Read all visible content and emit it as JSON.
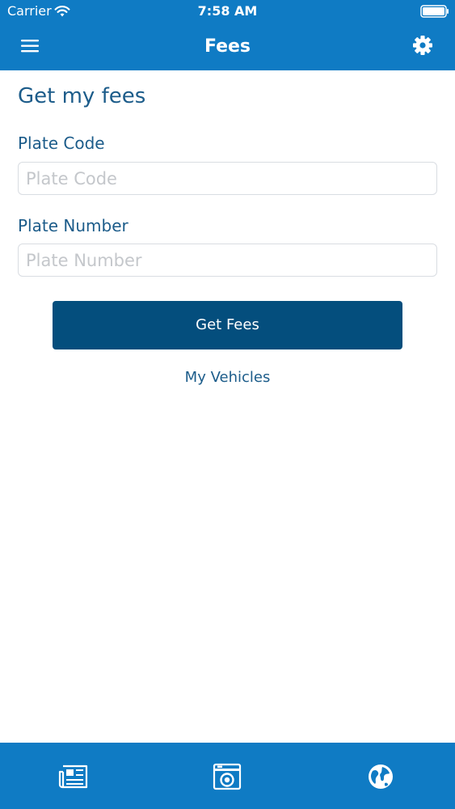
{
  "status_bar": {
    "carrier": "Carrier",
    "time": "7:58 AM"
  },
  "nav": {
    "title": "Fees",
    "menu_icon": "hamburger-menu-icon",
    "settings_icon": "gear-icon"
  },
  "form": {
    "title": "Get my fees",
    "plate_code": {
      "label": "Plate Code",
      "placeholder": "Plate Code",
      "value": ""
    },
    "plate_number": {
      "label": "Plate Number",
      "placeholder": "Plate Number",
      "value": ""
    },
    "submit_label": "Get Fees",
    "link_label": "My Vehicles"
  },
  "tab_bar": {
    "tabs": [
      {
        "icon": "news-icon"
      },
      {
        "icon": "camera-icon"
      },
      {
        "icon": "globe-icon"
      }
    ]
  },
  "colors": {
    "header_bg": "#0f7bc4",
    "primary_text": "#1c5c8a",
    "button_bg": "#044e7d",
    "placeholder": "#c4c7cb",
    "input_border": "#d9dde2"
  }
}
